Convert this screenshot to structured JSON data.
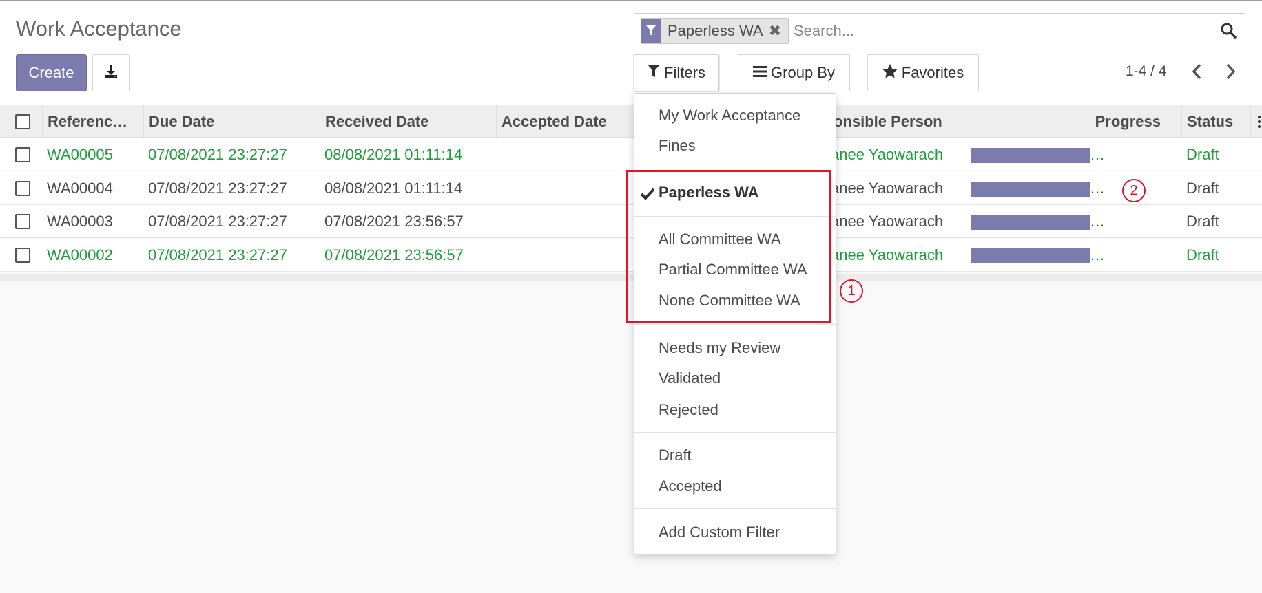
{
  "page": {
    "title": "Work Acceptance"
  },
  "toolbar": {
    "create_label": "Create",
    "download_icon": "download-icon"
  },
  "search": {
    "facet_label": "Paperless WA",
    "placeholder": "Search...",
    "filter_color": "#7c7bad"
  },
  "controls": {
    "filters_label": "Filters",
    "groupby_label": "Group By",
    "favorites_label": "Favorites"
  },
  "pager": {
    "value": "1-4 / 4"
  },
  "table": {
    "headers": [
      "Referenc…",
      "Due Date",
      "Received Date",
      "Accepted Date",
      "onsible Person",
      "Progress",
      "Status"
    ],
    "rows": [
      {
        "ref": "WA00005",
        "due": "07/08/2021 23:27:27",
        "received": "08/08/2021 01:11:14",
        "person": "anee Yaowarach",
        "progress": 1.0,
        "status": "Draft",
        "color": "#1f9e3a"
      },
      {
        "ref": "WA00004",
        "due": "07/08/2021 23:27:27",
        "received": "08/08/2021 01:11:14",
        "person": "anee Yaowarach",
        "progress": 1.0,
        "status": "Draft",
        "color": "#4c4c4c"
      },
      {
        "ref": "WA00003",
        "due": "07/08/2021 23:27:27",
        "received": "07/08/2021 23:56:57",
        "person": "anee Yaowarach",
        "progress": 1.0,
        "status": "Draft",
        "color": "#4c4c4c"
      },
      {
        "ref": "WA00002",
        "due": "07/08/2021 23:27:27",
        "received": "07/08/2021 23:56:57",
        "person": "anee Yaowarach",
        "progress": 1.0,
        "status": "Draft",
        "color": "#1f9e3a"
      }
    ],
    "ellipsis": "…"
  },
  "filters_menu": {
    "group1": [
      "My Work Acceptance",
      "Fines"
    ],
    "checked": "Paperless WA",
    "group2": [
      "All Committee WA",
      "Partial Committee WA",
      "None Committee WA"
    ],
    "group3": [
      "Needs my Review",
      "Validated",
      "Rejected"
    ],
    "group4": [
      "Draft",
      "Accepted"
    ],
    "custom": "Add Custom Filter"
  },
  "annotations": {
    "marker1": "1",
    "marker2": "2",
    "highlight_color": "#e0142b"
  }
}
